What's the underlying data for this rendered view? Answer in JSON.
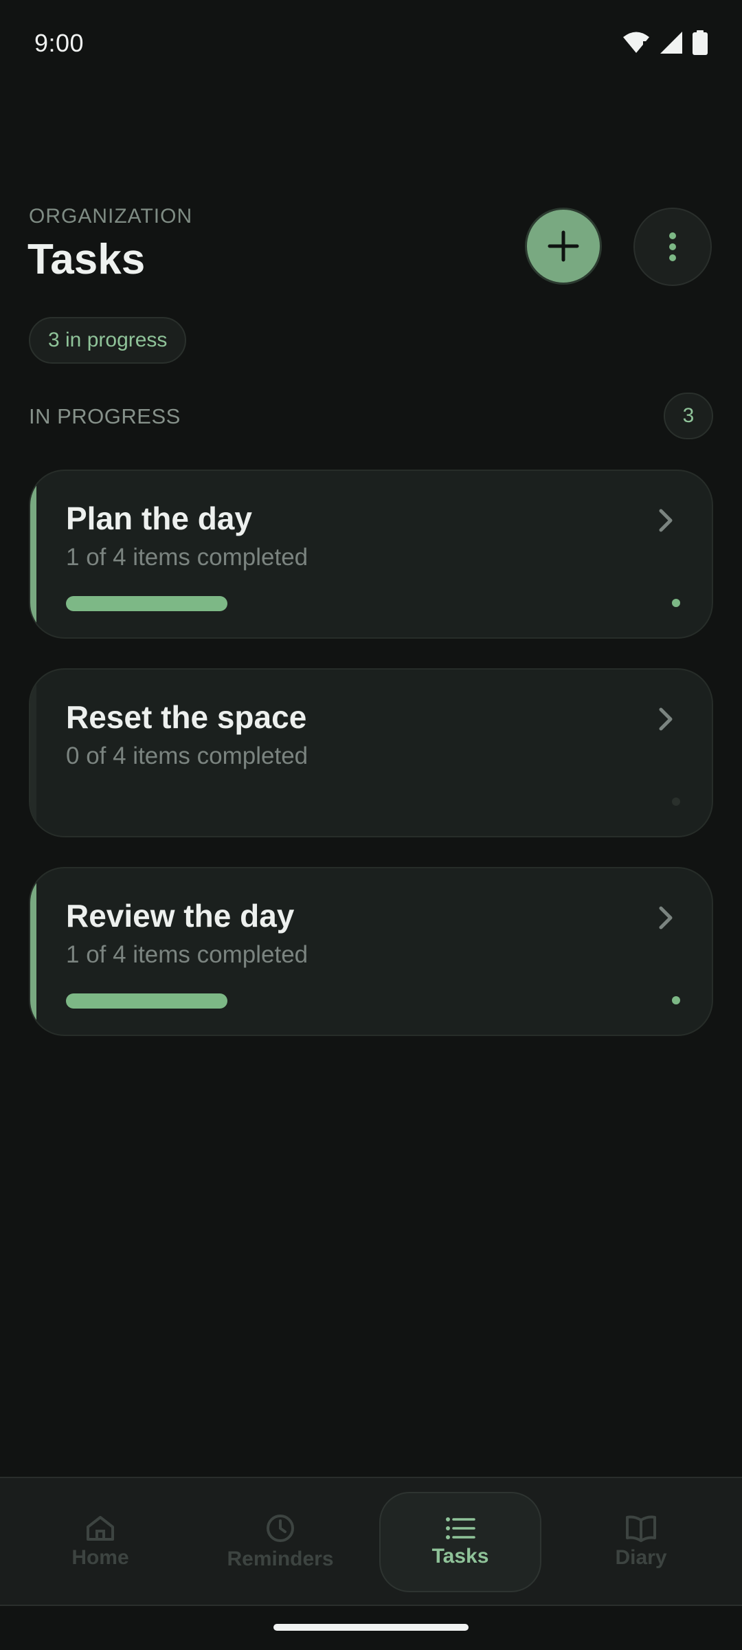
{
  "status_bar": {
    "time": "9:00",
    "icons": [
      "wifi-icon",
      "signal-icon",
      "battery-icon"
    ]
  },
  "header": {
    "eyebrow": "ORGANIZATION",
    "title": "Tasks",
    "add_icon": "plus-icon",
    "more_icon": "more-vertical-icon"
  },
  "summary_chip": "3 in progress",
  "section": {
    "label": "IN PROGRESS",
    "count": "3"
  },
  "tasks": [
    {
      "title": "Plan the day",
      "subtitle": "1 of 4 items completed",
      "completed": 1,
      "total": 4,
      "progress": 0.25
    },
    {
      "title": "Reset the space",
      "subtitle": "0 of 4 items completed",
      "completed": 0,
      "total": 4,
      "progress": 0.0
    },
    {
      "title": "Review the day",
      "subtitle": "1 of 4 items completed",
      "completed": 1,
      "total": 4,
      "progress": 0.25
    }
  ],
  "bottom_nav": {
    "items": [
      {
        "label": "Home",
        "icon": "home-icon",
        "active": false
      },
      {
        "label": "Reminders",
        "icon": "clock-icon",
        "active": false
      },
      {
        "label": "Tasks",
        "icon": "list-icon",
        "active": true
      },
      {
        "label": "Diary",
        "icon": "book-icon",
        "active": false
      }
    ]
  },
  "colors": {
    "background": "#111312",
    "accent": "#79a981",
    "accent_text": "#8fc399",
    "card": "#1b201e",
    "muted_text": "#7b8480"
  }
}
